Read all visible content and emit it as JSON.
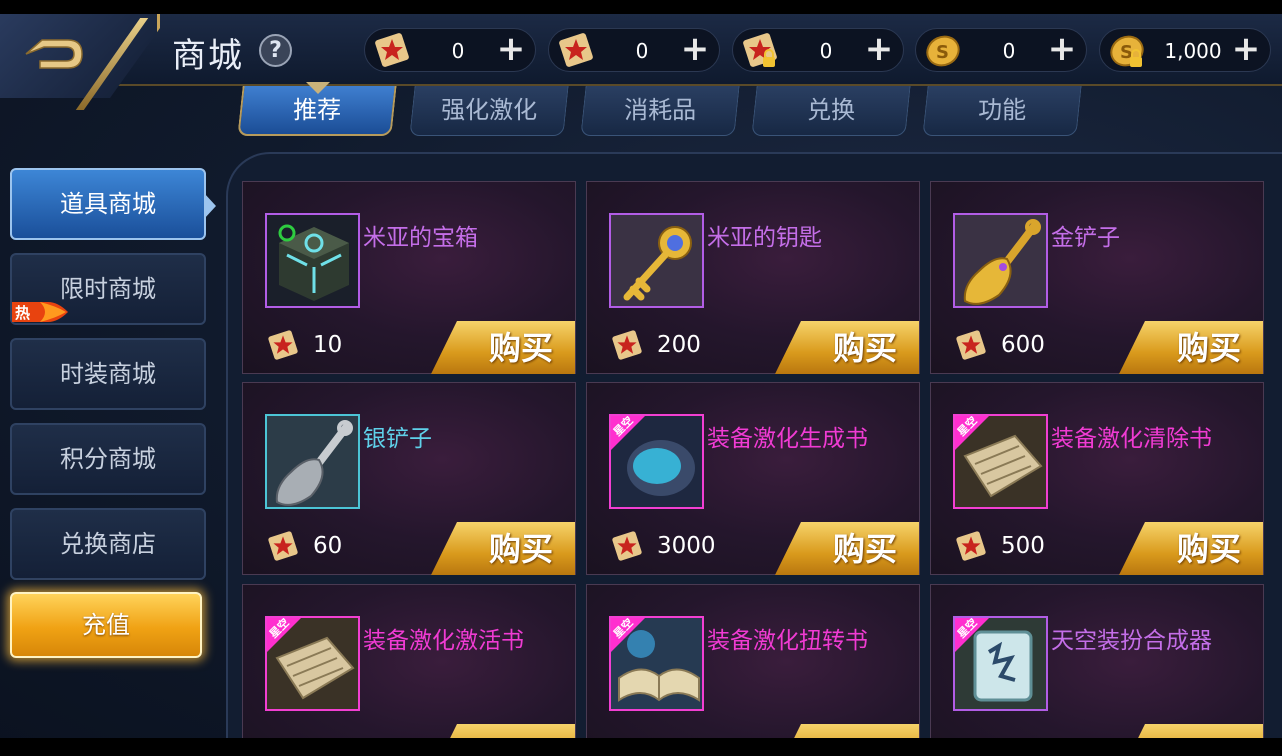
{
  "header": {
    "title": "商城",
    "help_label": "?",
    "currencies": [
      {
        "icon": "red-scroll-icon",
        "value": "0"
      },
      {
        "icon": "red-scroll-icon",
        "value": "0"
      },
      {
        "icon": "locked-scroll-icon",
        "value": "0"
      },
      {
        "icon": "gold-coin-icon",
        "value": "0"
      },
      {
        "icon": "locked-coin-icon",
        "value": "1,000"
      }
    ],
    "plus_label": "+"
  },
  "tabs": [
    {
      "label": "推荐",
      "active": true
    },
    {
      "label": "强化激化",
      "active": false
    },
    {
      "label": "消耗品",
      "active": false
    },
    {
      "label": "兑换",
      "active": false
    },
    {
      "label": "功能",
      "active": false
    }
  ],
  "sidebar": {
    "items": [
      {
        "label": "道具商城",
        "active": true
      },
      {
        "label": "限时商城",
        "active": false,
        "badge": "热"
      },
      {
        "label": "时装商城",
        "active": false
      },
      {
        "label": "积分商城",
        "active": false
      },
      {
        "label": "兑换商店",
        "active": false
      }
    ],
    "recharge_label": "充值"
  },
  "buy_label": "购买",
  "items": [
    {
      "name": "米亚的宝箱",
      "price": "10",
      "icon": "treasure-box-icon",
      "rarity": "purple"
    },
    {
      "name": "米亚的钥匙",
      "price": "200",
      "icon": "golden-key-icon",
      "rarity": "purple"
    },
    {
      "name": "金铲子",
      "price": "600",
      "icon": "golden-shovel-icon",
      "rarity": "purple"
    },
    {
      "name": "银铲子",
      "price": "60",
      "icon": "silver-shovel-icon",
      "rarity": "cyan"
    },
    {
      "name": "装备激化生成书",
      "price": "3000",
      "icon": "blue-book-icon",
      "rarity": "pink",
      "tag": "星空"
    },
    {
      "name": "装备激化清除书",
      "price": "500",
      "icon": "scroll-book-icon",
      "rarity": "pink",
      "tag": "星空"
    },
    {
      "name": "装备激化激活书",
      "price": "",
      "icon": "scroll-book-icon",
      "rarity": "pink",
      "tag": "星空"
    },
    {
      "name": "装备激化扭转书",
      "price": "",
      "icon": "open-book-icon",
      "rarity": "pink",
      "tag": "星空"
    },
    {
      "name": "天空装扮合成器",
      "price": "",
      "icon": "rune-tablet-icon",
      "rarity": "purple",
      "tag": "星空"
    }
  ],
  "colors": {
    "accent_gold": "#d99a1c",
    "tab_active": "#2f6fc0",
    "rarity_purple": "#b25de6",
    "rarity_pink": "#f23fd2",
    "rarity_cyan": "#4cc5d6"
  }
}
